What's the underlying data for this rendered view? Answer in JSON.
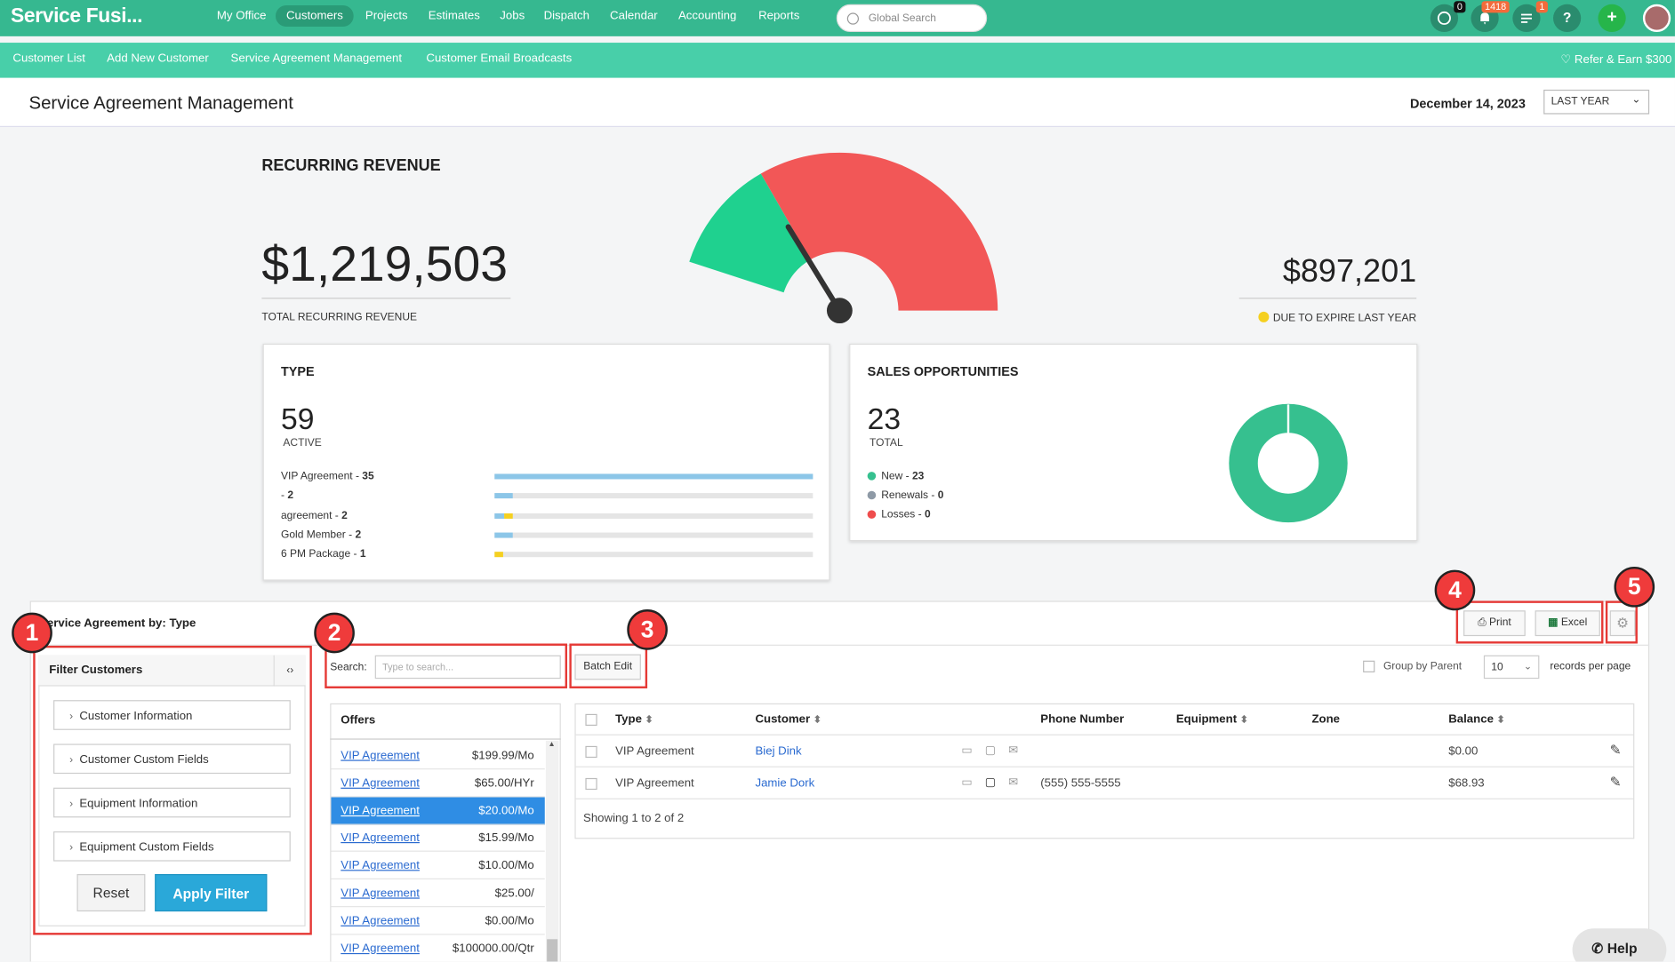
{
  "app": {
    "logo": "Service Fusi..."
  },
  "topnav": {
    "items": [
      "My Office",
      "Customers",
      "Projects",
      "Estimates",
      "Jobs",
      "Dispatch",
      "Calendar",
      "Accounting",
      "Reports"
    ],
    "active": "Customers",
    "search_placeholder": "Global Search",
    "chat_count": "0",
    "notification_count": "1418",
    "tasks_count": "1",
    "help_icon": "?",
    "add_icon": "+"
  },
  "subnav": {
    "items": [
      "Customer List",
      "Add New Customer",
      "Service Agreement Management",
      "Customer Email Broadcasts"
    ],
    "refer": "Refer & Earn $300"
  },
  "header": {
    "title": "Service Agreement Management",
    "date": "December 14, 2023",
    "range": "LAST YEAR"
  },
  "revenue": {
    "title": "RECURRING REVENUE",
    "total": "$1,219,503",
    "total_label": "TOTAL RECURRING REVENUE",
    "expiring": "$897,201",
    "expiring_label": "DUE TO EXPIRE LAST YEAR",
    "gauge": {
      "green_fraction": 0.26,
      "needle_fraction": 0.25,
      "green": "#1fd18f",
      "red": "#f25757"
    }
  },
  "type_card": {
    "title": "TYPE",
    "count": "59",
    "count_label": "ACTIVE",
    "rows": [
      {
        "name": "VIP Agreement",
        "value": "35",
        "fraction": 1.0,
        "accent": 0
      },
      {
        "name": "",
        "value": "2",
        "fraction": 0.057,
        "accent": 0
      },
      {
        "name": "agreement",
        "value": "2",
        "fraction": 0.03,
        "accent": 0.027
      },
      {
        "name": "Gold Member",
        "value": "2",
        "fraction": 0.057,
        "accent": 0
      },
      {
        "name": "6 PM Package",
        "value": "1",
        "fraction": 0,
        "accent": 0.028
      }
    ]
  },
  "sales_card": {
    "title": "SALES OPPORTUNITIES",
    "count": "23",
    "count_label": "TOTAL",
    "legend": [
      {
        "label": "New",
        "value": "23",
        "color": "#36c08f"
      },
      {
        "label": "Renewals",
        "value": "0",
        "color": "#8e9aa6"
      },
      {
        "label": "Losses",
        "value": "0",
        "color": "#ef4d4d"
      }
    ]
  },
  "lower": {
    "title": "ervice Agreement by: Type",
    "print_label": "Print",
    "excel_label": "Excel",
    "markers": [
      "1",
      "2",
      "3",
      "4",
      "5"
    ]
  },
  "filter": {
    "title": "Filter Customers",
    "toggle": "‹›",
    "sections": [
      "Customer Information",
      "Customer Custom Fields",
      "Equipment Information",
      "Equipment Custom Fields"
    ],
    "reset_label": "Reset",
    "apply_label": "Apply Filter"
  },
  "toolbar": {
    "search_label": "Search:",
    "search_placeholder": "Type to search...",
    "batch_label": "Batch Edit",
    "group_label": "Group by Parent",
    "per_page": "10",
    "per_page_label": "records per page"
  },
  "offers": {
    "title": "Offers",
    "items": [
      {
        "name": "VIP Agreement",
        "price": "$199.99/Mo"
      },
      {
        "name": "VIP Agreement",
        "price": "$65.00/HYr"
      },
      {
        "name": "VIP Agreement",
        "price": "$20.00/Mo"
      },
      {
        "name": "VIP Agreement",
        "price": "$15.99/Mo"
      },
      {
        "name": "VIP Agreement",
        "price": "$10.00/Mo"
      },
      {
        "name": "VIP Agreement",
        "price": "$25.00/"
      },
      {
        "name": "VIP Agreement",
        "price": "$0.00/Mo"
      },
      {
        "name": "VIP Agreement",
        "price": "$100000.00/Qtr"
      }
    ],
    "selected_index": 2
  },
  "table": {
    "columns": [
      "Type",
      "Customer",
      "Phone Number",
      "Equipment",
      "Zone",
      "Balance"
    ],
    "rows": [
      {
        "type": "VIP Agreement",
        "customer": "Biej Dink",
        "phone": "",
        "equipment": "",
        "zone": "",
        "balance": "$0.00"
      },
      {
        "type": "VIP Agreement",
        "customer": "Jamie Dork",
        "phone": "(555) 555-5555",
        "equipment": "",
        "zone": "",
        "balance": "$68.93"
      }
    ],
    "footer": "Showing 1 to 2 of 2"
  },
  "help": {
    "label": "Help"
  }
}
